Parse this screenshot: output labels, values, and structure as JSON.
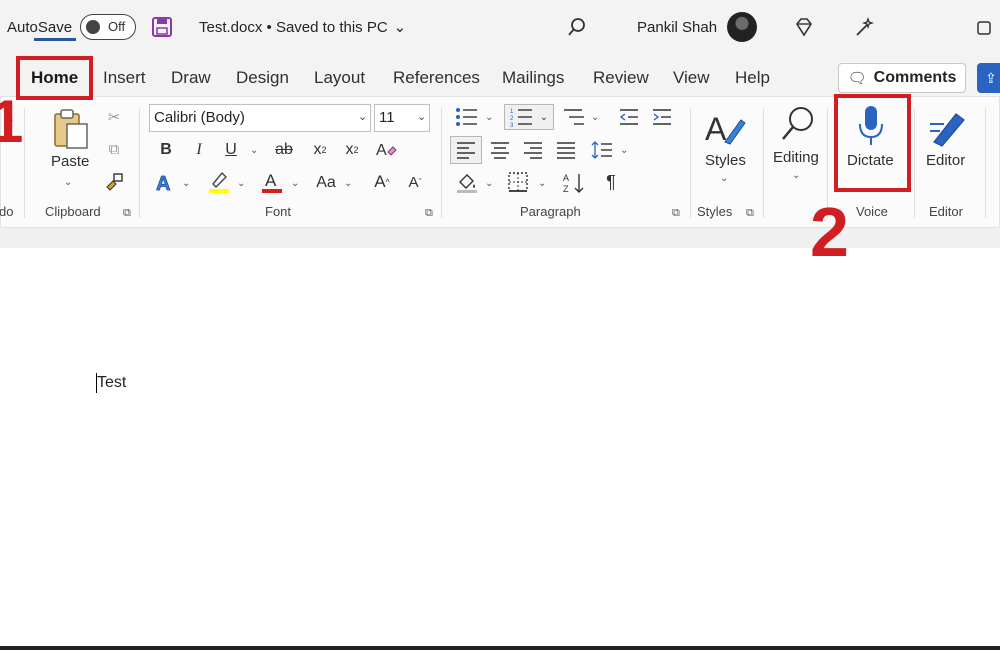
{
  "titlebar": {
    "autosave_label": "AutoSave",
    "autosave_state": "Off",
    "doc_title": "Test.docx • Saved to this PC",
    "title_chevron": "⌄",
    "user_name": "Pankil Shah"
  },
  "tabs": [
    "Home",
    "Insert",
    "Draw",
    "Design",
    "Layout",
    "References",
    "Mailings",
    "Review",
    "View",
    "Help"
  ],
  "comments_label": "Comments",
  "ribbon": {
    "undo_group_label": "do",
    "clipboard": {
      "label": "Clipboard",
      "paste_label": "Paste"
    },
    "font": {
      "label": "Font",
      "font_name": "Calibri (Body)",
      "font_size": "11"
    },
    "paragraph": {
      "label": "Paragraph"
    },
    "styles": {
      "label": "Styles",
      "button_label": "Styles"
    },
    "editing": {
      "button_label": "Editing"
    },
    "voice": {
      "label": "Voice",
      "dictate_label": "Dictate"
    },
    "editor": {
      "label": "Editor",
      "button_label": "Editor"
    }
  },
  "annotations": {
    "step1": "1",
    "step2": "2"
  },
  "document": {
    "text": "Test"
  },
  "colors": {
    "accent": "#2b579a",
    "highlight_red": "#d01e22",
    "font_color_bar": "#d01e22",
    "highlight_yellow": "#ffff00"
  }
}
